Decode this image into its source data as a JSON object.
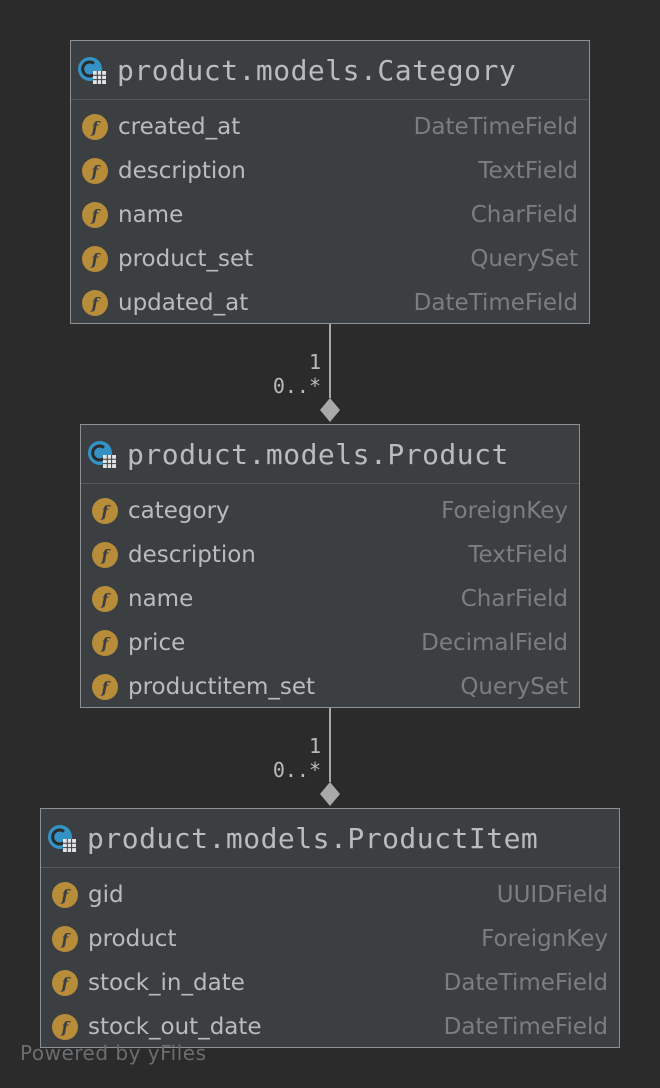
{
  "classes": [
    {
      "title": "product.models.Category",
      "fields": [
        {
          "name": "created_at",
          "type": "DateTimeField"
        },
        {
          "name": "description",
          "type": "TextField"
        },
        {
          "name": "name",
          "type": "CharField"
        },
        {
          "name": "product_set",
          "type": "QuerySet"
        },
        {
          "name": "updated_at",
          "type": "DateTimeField"
        }
      ]
    },
    {
      "title": "product.models.Product",
      "fields": [
        {
          "name": "category",
          "type": "ForeignKey"
        },
        {
          "name": "description",
          "type": "TextField"
        },
        {
          "name": "name",
          "type": "CharField"
        },
        {
          "name": "price",
          "type": "DecimalField"
        },
        {
          "name": "productitem_set",
          "type": "QuerySet"
        }
      ]
    },
    {
      "title": "product.models.ProductItem",
      "fields": [
        {
          "name": "gid",
          "type": "UUIDField"
        },
        {
          "name": "product",
          "type": "ForeignKey"
        },
        {
          "name": "stock_in_date",
          "type": "DateTimeField"
        },
        {
          "name": "stock_out_date",
          "type": "DateTimeField"
        }
      ]
    }
  ],
  "relations": [
    {
      "from_mult": "1",
      "to_mult": "0..*"
    },
    {
      "from_mult": "1",
      "to_mult": "0..*"
    }
  ],
  "field_icon_glyph": "f",
  "footer": "Powered by yFiles",
  "colors": {
    "background": "#2b2b2b",
    "box": "#3c3f41",
    "border": "#8e9193",
    "field_icon": "#b88d3a",
    "class_icon": "#3592c4",
    "text": "#bbbbbb",
    "type_text": "#7b7e81"
  }
}
